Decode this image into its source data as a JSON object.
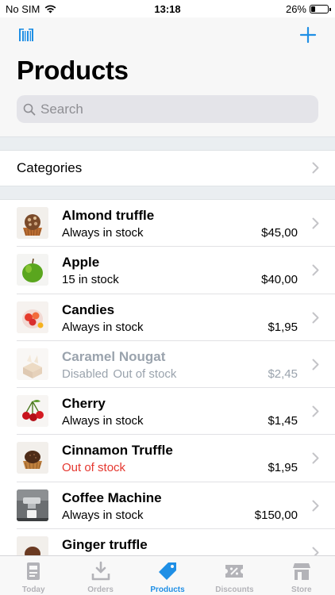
{
  "status_bar": {
    "carrier": "No SIM",
    "time": "13:18",
    "battery_percent": "26%",
    "battery_level": 0.26
  },
  "header": {
    "title": "Products",
    "barcode_icon": "barcode-icon",
    "add_icon": "plus-icon",
    "accent_color": "#1f8fe5"
  },
  "search": {
    "placeholder": "Search"
  },
  "categories": {
    "label": "Categories"
  },
  "products": [
    {
      "name": "Almond truffle",
      "stock": "Always in stock",
      "price": "$45,00",
      "state": "normal",
      "icon": "almond-truffle-image"
    },
    {
      "name": "Apple",
      "stock": "15 in stock",
      "price": "$40,00",
      "state": "normal",
      "icon": "apple-image"
    },
    {
      "name": "Candies",
      "stock": "Always in stock",
      "price": "$1,95",
      "state": "normal",
      "icon": "candies-image"
    },
    {
      "name": "Caramel Nougat",
      "stock": "Disabled",
      "stock_secondary": "Out of stock",
      "price": "$2,45",
      "state": "disabled",
      "icon": "caramel-nougat-image"
    },
    {
      "name": "Cherry",
      "stock": "Always in stock",
      "price": "$1,45",
      "state": "normal",
      "icon": "cherry-image"
    },
    {
      "name": "Cinnamon Truffle",
      "stock": "Out of stock",
      "price": "$1,95",
      "state": "out",
      "icon": "cinnamon-truffle-image"
    },
    {
      "name": "Coffee Machine",
      "stock": "Always in stock",
      "price": "$150,00",
      "state": "normal",
      "icon": "coffee-machine-image"
    },
    {
      "name": "Ginger truffle",
      "stock": "",
      "price": "",
      "state": "normal",
      "icon": "ginger-truffle-image"
    }
  ],
  "tabs": [
    {
      "label": "Today",
      "icon": "today-icon",
      "active": false
    },
    {
      "label": "Orders",
      "icon": "orders-icon",
      "active": false
    },
    {
      "label": "Products",
      "icon": "tag-icon",
      "active": true
    },
    {
      "label": "Discounts",
      "icon": "discount-icon",
      "active": false
    },
    {
      "label": "Store",
      "icon": "store-icon",
      "active": false
    }
  ]
}
